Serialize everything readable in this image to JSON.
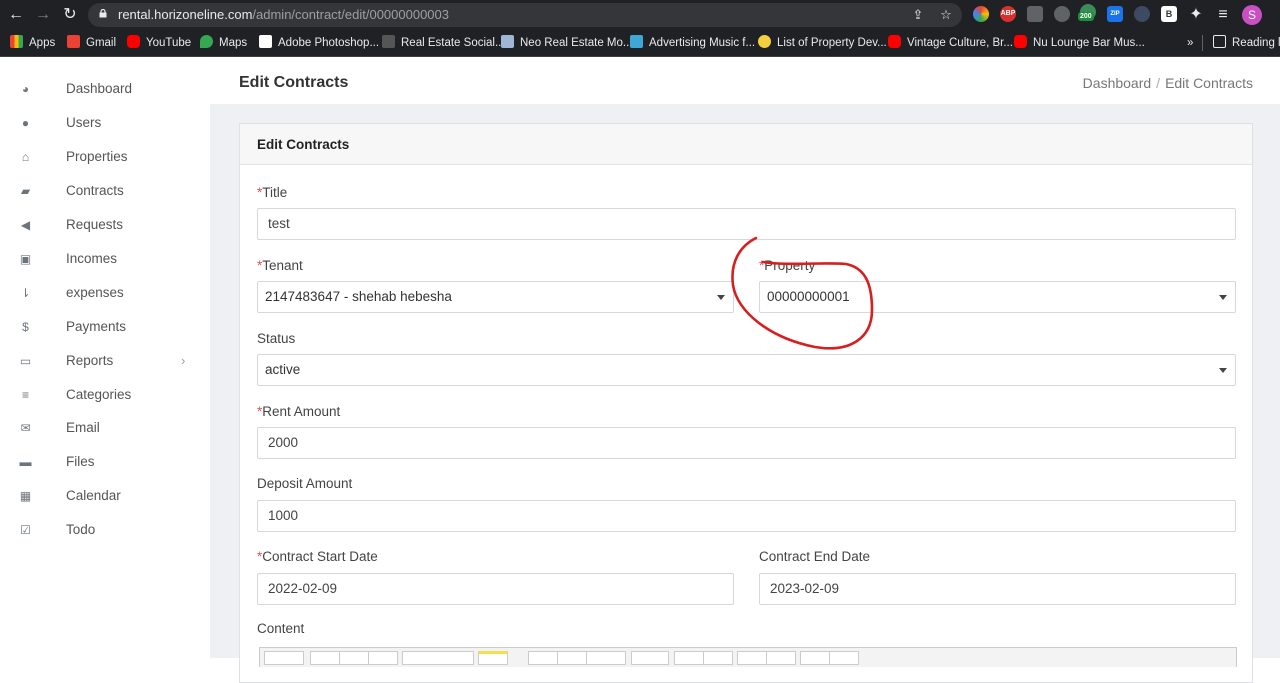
{
  "browser": {
    "url_host": "rental.horizoneline.com",
    "url_path": "/admin/contract/edit/00000000003",
    "ext_badge": "200",
    "ext_abp": "ABP",
    "ext_zip": "ZIP",
    "ext_b": "B",
    "profile_initial": "S",
    "bookmarks": [
      {
        "label": "Apps",
        "color": "#ea4335"
      },
      {
        "label": "Gmail",
        "color": "#ea4335"
      },
      {
        "label": "YouTube",
        "color": "#ff0000"
      },
      {
        "label": "Maps",
        "color": "#34a853"
      },
      {
        "label": "Adobe Photoshop...",
        "color": "#ffffff"
      },
      {
        "label": "Real Estate Social...",
        "color": "#ffffff"
      },
      {
        "label": "Neo Real Estate Mo...",
        "color": "#9fb6d6"
      },
      {
        "label": "Advertising Music f...",
        "color": "#3fa7d6"
      },
      {
        "label": "List of Property Dev...",
        "color": "#f4d03f"
      },
      {
        "label": "Vintage Culture, Br...",
        "color": "#ff0000"
      },
      {
        "label": "Nu Lounge Bar Mus...",
        "color": "#ff0000"
      }
    ],
    "more": "»",
    "reading_list": "Reading lis"
  },
  "sidebar": {
    "items": [
      {
        "label": "Dashboard",
        "icon": "palette-icon",
        "glyph": "◕"
      },
      {
        "label": "Users",
        "icon": "users-icon",
        "glyph": "●"
      },
      {
        "label": "Properties",
        "icon": "home-icon",
        "glyph": "⌂"
      },
      {
        "label": "Contracts",
        "icon": "book-icon",
        "glyph": "▰"
      },
      {
        "label": "Requests",
        "icon": "megaphone-icon",
        "glyph": "◀"
      },
      {
        "label": "Incomes",
        "icon": "money-icon",
        "glyph": "▣"
      },
      {
        "label": "expenses",
        "icon": "sort-list-icon",
        "glyph": "⇂"
      },
      {
        "label": "Payments",
        "icon": "dollar-icon",
        "glyph": "$"
      },
      {
        "label": "Reports",
        "icon": "inbox-icon",
        "glyph": "▭",
        "chevron": "›"
      },
      {
        "label": "Categories",
        "icon": "list-icon",
        "glyph": "≡"
      },
      {
        "label": "Email",
        "icon": "envelope-icon",
        "glyph": "✉"
      },
      {
        "label": "Files",
        "icon": "folder-icon",
        "glyph": "▬"
      },
      {
        "label": "Calendar",
        "icon": "calendar-icon",
        "glyph": "▦"
      },
      {
        "label": "Todo",
        "icon": "checkbox-icon",
        "glyph": "☑"
      }
    ]
  },
  "header": {
    "title": "Edit Contracts",
    "breadcrumb": [
      "Dashboard",
      "Edit Contracts"
    ],
    "breadcrumb_sep": "/"
  },
  "form": {
    "card_title": "Edit Contracts",
    "required_mark": "*",
    "title_label": "Title",
    "title_value": "test",
    "tenant_label": "Tenant",
    "tenant_value": "2147483647 - shehab hebesha",
    "property_label": "Property",
    "property_value": "00000000001",
    "status_label": "Status",
    "status_value": "active",
    "rent_label": "Rent Amount",
    "rent_value": "2000",
    "deposit_label": "Deposit Amount",
    "deposit_value": "1000",
    "start_label": "Contract Start Date",
    "start_value": "2022-02-09",
    "end_label": "Contract End Date",
    "end_value": "2023-02-09",
    "content_label": "Content"
  },
  "colors": {
    "annotation": "#d62020",
    "required": "#d9534f"
  }
}
